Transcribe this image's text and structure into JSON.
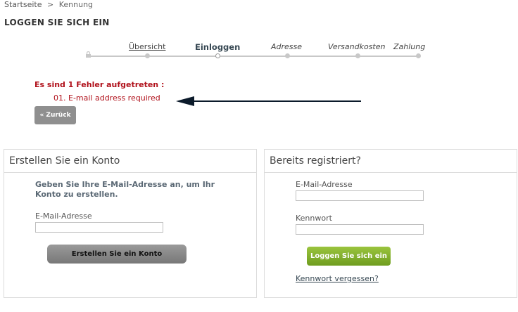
{
  "breadcrumb": {
    "home": "Startseite",
    "separator": ">",
    "current": "Kennung"
  },
  "page_title": "LOGGEN SIE SICH EIN",
  "steps": [
    "Übersicht",
    "Einloggen",
    "Adresse",
    "Versandkosten",
    "Zahlung"
  ],
  "error": {
    "title": "Es sind 1 Fehler aufgetreten :",
    "item": "01. E-mail address required"
  },
  "back_button": "« Zurück",
  "create": {
    "heading": "Erstellen Sie ein Konto",
    "intro": "Geben Sie Ihre E-Mail-Adresse an, um Ihr Konto zu erstellen.",
    "email_label": "E-Mail-Adresse",
    "email_value": "",
    "button": "Erstellen Sie ein Konto"
  },
  "login": {
    "heading": "Bereits registriert?",
    "email_label": "E-Mail-Adresse",
    "email_value": "",
    "password_label": "Kennwort",
    "password_value": "",
    "button": "Loggen Sie sich ein",
    "forgot": "Kennwort vergessen?"
  },
  "colors": {
    "error": "#b0101a",
    "login_button": "#7fae2b",
    "create_button": "#888888"
  }
}
